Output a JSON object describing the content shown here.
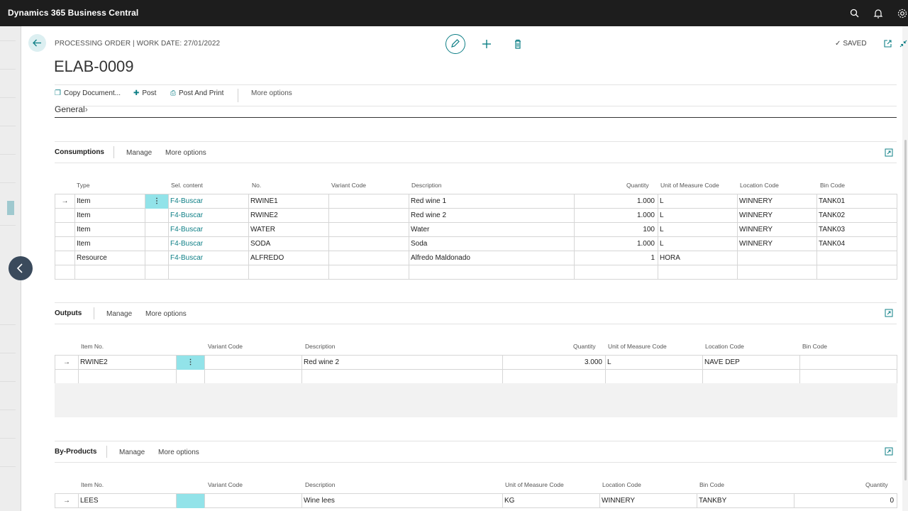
{
  "app": {
    "title": "Dynamics 365 Business Central"
  },
  "topbar": {
    "search_icon": "search-icon",
    "bell_icon": "bell-icon",
    "settings_icon": "gear-icon"
  },
  "header": {
    "caption": "PROCESSING ORDER | WORK DATE: 27/01/2022",
    "title": "ELAB-0009",
    "saved_label": "SAVED"
  },
  "actions": {
    "copy_document": "Copy Document...",
    "post": "Post",
    "post_and_print": "Post And Print",
    "more_options": "More options"
  },
  "general": {
    "label": "General"
  },
  "consumptions": {
    "title": "Consumptions",
    "manage": "Manage",
    "more_options": "More options",
    "columns": [
      "Type",
      "Sel. content",
      "No.",
      "Variant Code",
      "Description",
      "Quantity",
      "Unit of Measure Code",
      "Location Code",
      "Bin Code"
    ],
    "rows": [
      {
        "type": "Item",
        "sel": "F4-Buscar",
        "no": "RWINE1",
        "variant": "",
        "description": "Red wine 1",
        "quantity": "1.000",
        "uom": "L",
        "location": "WINNERY",
        "bin": "TANK01"
      },
      {
        "type": "Item",
        "sel": "F4-Buscar",
        "no": "RWINE2",
        "variant": "",
        "description": "Red wine 2",
        "quantity": "1.000",
        "uom": "L",
        "location": "WINNERY",
        "bin": "TANK02"
      },
      {
        "type": "Item",
        "sel": "F4-Buscar",
        "no": "WATER",
        "variant": "",
        "description": "Water",
        "quantity": "100",
        "uom": "L",
        "location": "WINNERY",
        "bin": "TANK03"
      },
      {
        "type": "Item",
        "sel": "F4-Buscar",
        "no": "SODA",
        "variant": "",
        "description": "Soda",
        "quantity": "1.000",
        "uom": "L",
        "location": "WINNERY",
        "bin": "TANK04"
      },
      {
        "type": "Resource",
        "sel": "F4-Buscar",
        "no": "ALFREDO",
        "variant": "",
        "description": "Alfredo Maldonado",
        "quantity": "1",
        "uom": "HORA",
        "location": "",
        "bin": ""
      }
    ]
  },
  "outputs": {
    "title": "Outputs",
    "manage": "Manage",
    "more_options": "More options",
    "columns": [
      "Item No.",
      "Variant Code",
      "Description",
      "Quantity",
      "Unit of Measure Code",
      "Location Code",
      "Bin Code"
    ],
    "rows": [
      {
        "item_no": "RWINE2",
        "variant": "",
        "description": "Red wine 2",
        "quantity": "3.000",
        "uom": "L",
        "location": "NAVE DEP",
        "bin": ""
      }
    ]
  },
  "byproducts": {
    "title": "By-Products",
    "manage": "Manage",
    "more_options": "More options",
    "columns": [
      "Item No.",
      "Variant Code",
      "Description",
      "Unit of Measure Code",
      "Location Code",
      "Bin Code",
      "Quantity"
    ],
    "rows": [
      {
        "item_no": "LEES",
        "variant": "",
        "description": "Wine lees",
        "uom": "KG",
        "location": "WINNERY",
        "bin": "TANKBY",
        "quantity": "0"
      }
    ]
  },
  "colors": {
    "accent": "#0e7f86",
    "topbar": "#1d1d1d",
    "selected_cell": "#92e3e9"
  }
}
